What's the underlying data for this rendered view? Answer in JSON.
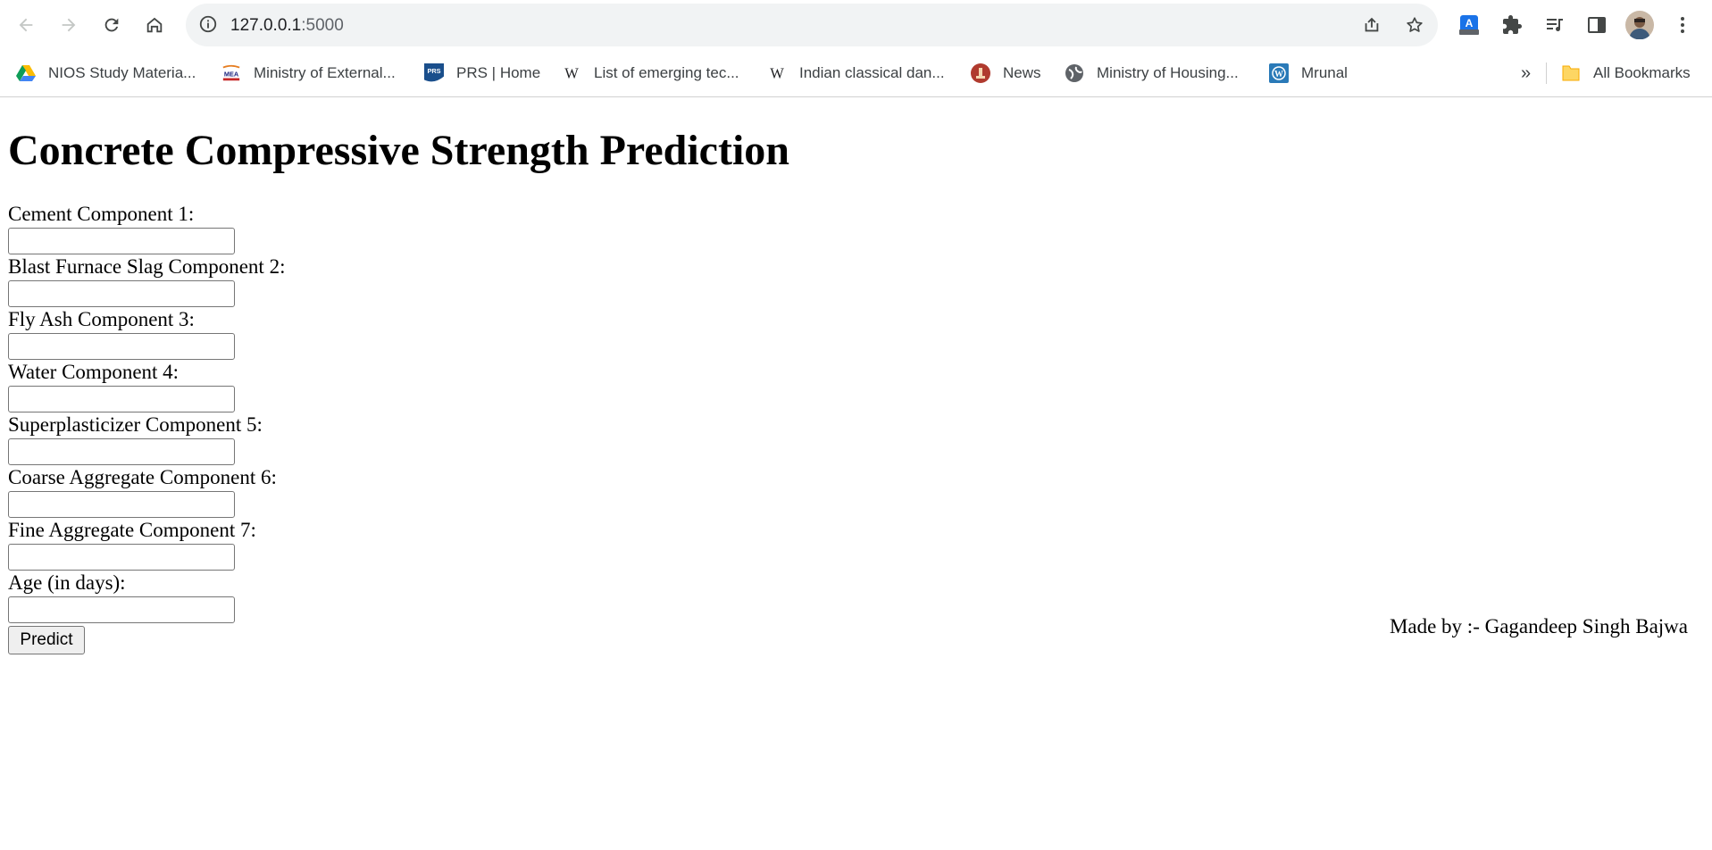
{
  "browser": {
    "url_host": "127.0.0.1",
    "url_port": ":5000",
    "bookmarks": [
      {
        "label": "NIOS Study Materia...",
        "icon": "google-drive-icon"
      },
      {
        "label": "Ministry of External...",
        "icon": "mea-icon"
      },
      {
        "label": "PRS | Home",
        "icon": "prs-icon"
      },
      {
        "label": "List of emerging tec...",
        "icon": "wikipedia-icon"
      },
      {
        "label": "Indian classical dan...",
        "icon": "wikipedia-icon"
      },
      {
        "label": "News",
        "icon": "news-emblem-icon"
      },
      {
        "label": "Ministry of Housing...",
        "icon": "globe-icon"
      },
      {
        "label": "Mrunal",
        "icon": "wordpress-icon"
      }
    ],
    "overflow_label": "»",
    "all_bookmarks_label": "All Bookmarks"
  },
  "page": {
    "title": "Concrete Compressive Strength Prediction",
    "fields": [
      {
        "label": "Cement Component 1:",
        "value": ""
      },
      {
        "label": "Blast Furnace Slag Component 2:",
        "value": ""
      },
      {
        "label": "Fly Ash Component 3:",
        "value": ""
      },
      {
        "label": "Water Component 4:",
        "value": ""
      },
      {
        "label": "Superplasticizer Component 5:",
        "value": ""
      },
      {
        "label": "Coarse Aggregate Component 6:",
        "value": ""
      },
      {
        "label": "Fine Aggregate Component 7:",
        "value": ""
      },
      {
        "label": "Age (in days):",
        "value": ""
      }
    ],
    "predict_label": "Predict",
    "credit": "Made by :- Gagandeep Singh Bajwa"
  }
}
